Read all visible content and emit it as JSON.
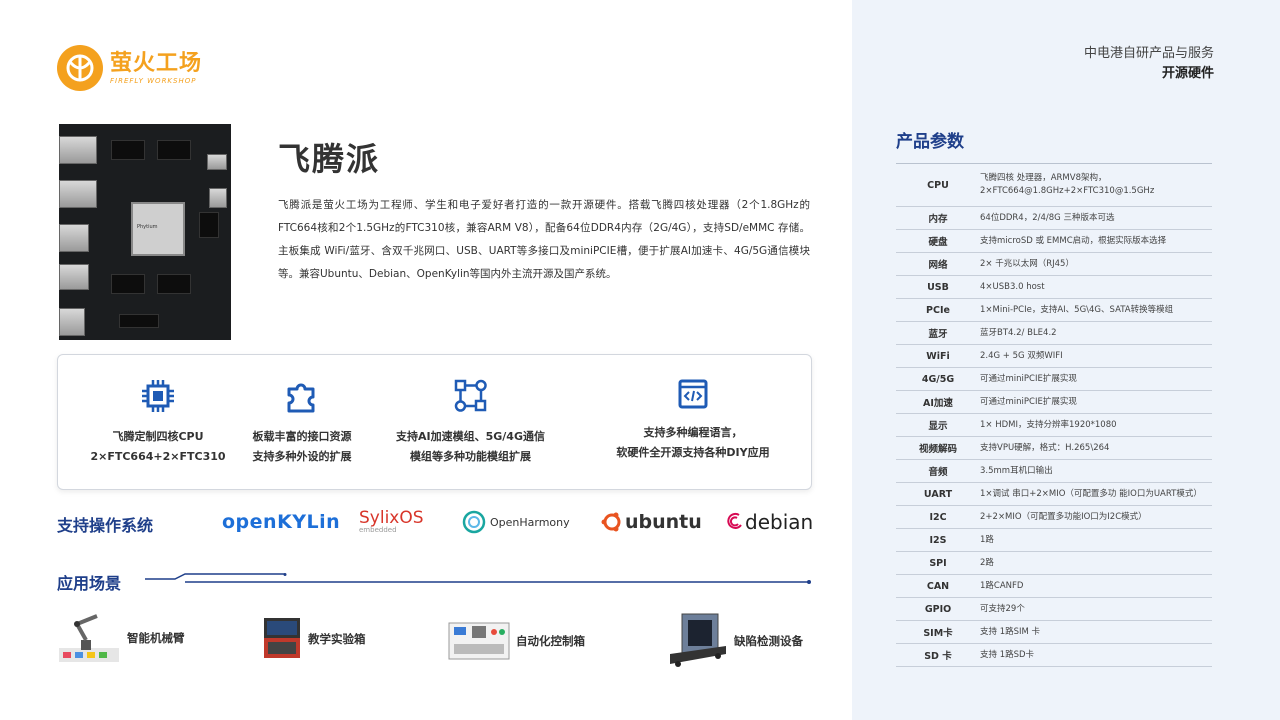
{
  "brand": {
    "logo_cn": "萤火工场",
    "logo_en": "FIREFLY WORKSHOP",
    "line1": "中电港自研产品与服务",
    "line2": "开源硬件"
  },
  "product": {
    "title": "飞腾派",
    "description": "飞腾派是萤火工场为工程师、学生和电子爱好者打造的一款开源硬件。搭载飞腾四核处理器（2个1.8GHz的FTC664核和2个1.5GHz的FTC310核，兼容ARM V8），配备64位DDR4内存（2G/4G），支持SD/eMMC 存储。主板集成 WiFi/蓝牙、含双千兆网口、USB、UART等多接口及miniPCIE槽，便于扩展AI加速卡、4G/5G通信模块等。兼容Ubuntu、Debian、OpenKylin等国内外主流开源及国产系统。",
    "chip_label": "Phytium"
  },
  "features": [
    {
      "icon": "cpu-chip-icon",
      "line1": "飞腾定制四核CPU",
      "line2": "2×FTC664+2×FTC310"
    },
    {
      "icon": "puzzle-icon",
      "line1": "板载丰富的接口资源",
      "line2": "支持多种外设的扩展"
    },
    {
      "icon": "module-network-icon",
      "line1": "支持AI加速模组、5G/4G通信",
      "line2": "模组等多种功能模组扩展"
    },
    {
      "icon": "code-window-icon",
      "line1": "支持多种编程语言，",
      "line2": "软硬件全开源支持各种DIY应用"
    }
  ],
  "os_section": {
    "title": "支持操作系统",
    "logos": {
      "openkylin_a": "open",
      "openkylin_b": "KYLin",
      "sylix": "SylixOS",
      "sylix_sub": "embedded",
      "openharmony": "OpenHarmony",
      "ubuntu": "ubuntu",
      "debian": "debian"
    }
  },
  "scene_section": {
    "title": "应用场景",
    "items": [
      "智能机械臂",
      "教学实验箱",
      "自动化控制箱",
      "缺陷检测设备"
    ]
  },
  "params": {
    "title": "产品参数",
    "rows": [
      {
        "k": "CPU",
        "v": "飞腾四核 处理器，ARMV8架构，",
        "v2": "2×FTC664@1.8GHz+2×FTC310@1.5GHz"
      },
      {
        "k": "内存",
        "v": "64位DDR4，2/4/8G 三种版本可选"
      },
      {
        "k": "硬盘",
        "v": "支持microSD 或 EMMC启动，根据实际版本选择"
      },
      {
        "k": "网络",
        "v": "2× 千兆以太网（RJ45）"
      },
      {
        "k": "USB",
        "v": "4×USB3.0 host"
      },
      {
        "k": "PCIe",
        "v": "1×Mini-PCIe，支持AI、5G\\4G、SATA转换等模组"
      },
      {
        "k": "蓝牙",
        "v": "蓝牙BT4.2/ BLE4.2"
      },
      {
        "k": "WiFi",
        "v": "2.4G + 5G 双频WIFI"
      },
      {
        "k": "4G/5G",
        "v": "可通过miniPCIE扩展实现"
      },
      {
        "k": "AI加速",
        "v": "可通过miniPCIE扩展实现"
      },
      {
        "k": "显示",
        "v": "1× HDMI，支持分辨率1920*1080"
      },
      {
        "k": "视频解码",
        "v": "支持VPU硬解，格式：H.265\\264"
      },
      {
        "k": "音频",
        "v": "3.5mm耳机口输出"
      },
      {
        "k": "UART",
        "v": "1×调试 串口+2×MIO（可配置多功 能IO口为UART模式）"
      },
      {
        "k": "I2C",
        "v": "2+2×MIO（可配置多功能IO口为I2C模式）"
      },
      {
        "k": "I2S",
        "v": "1路"
      },
      {
        "k": "SPI",
        "v": "2路"
      },
      {
        "k": "CAN",
        "v": "1路CANFD"
      },
      {
        "k": "GPIO",
        "v": "可支持29个"
      },
      {
        "k": "SIM卡",
        "v": "支持 1路SIM 卡"
      },
      {
        "k": "SD 卡",
        "v": "支持 1路SD卡"
      }
    ]
  }
}
